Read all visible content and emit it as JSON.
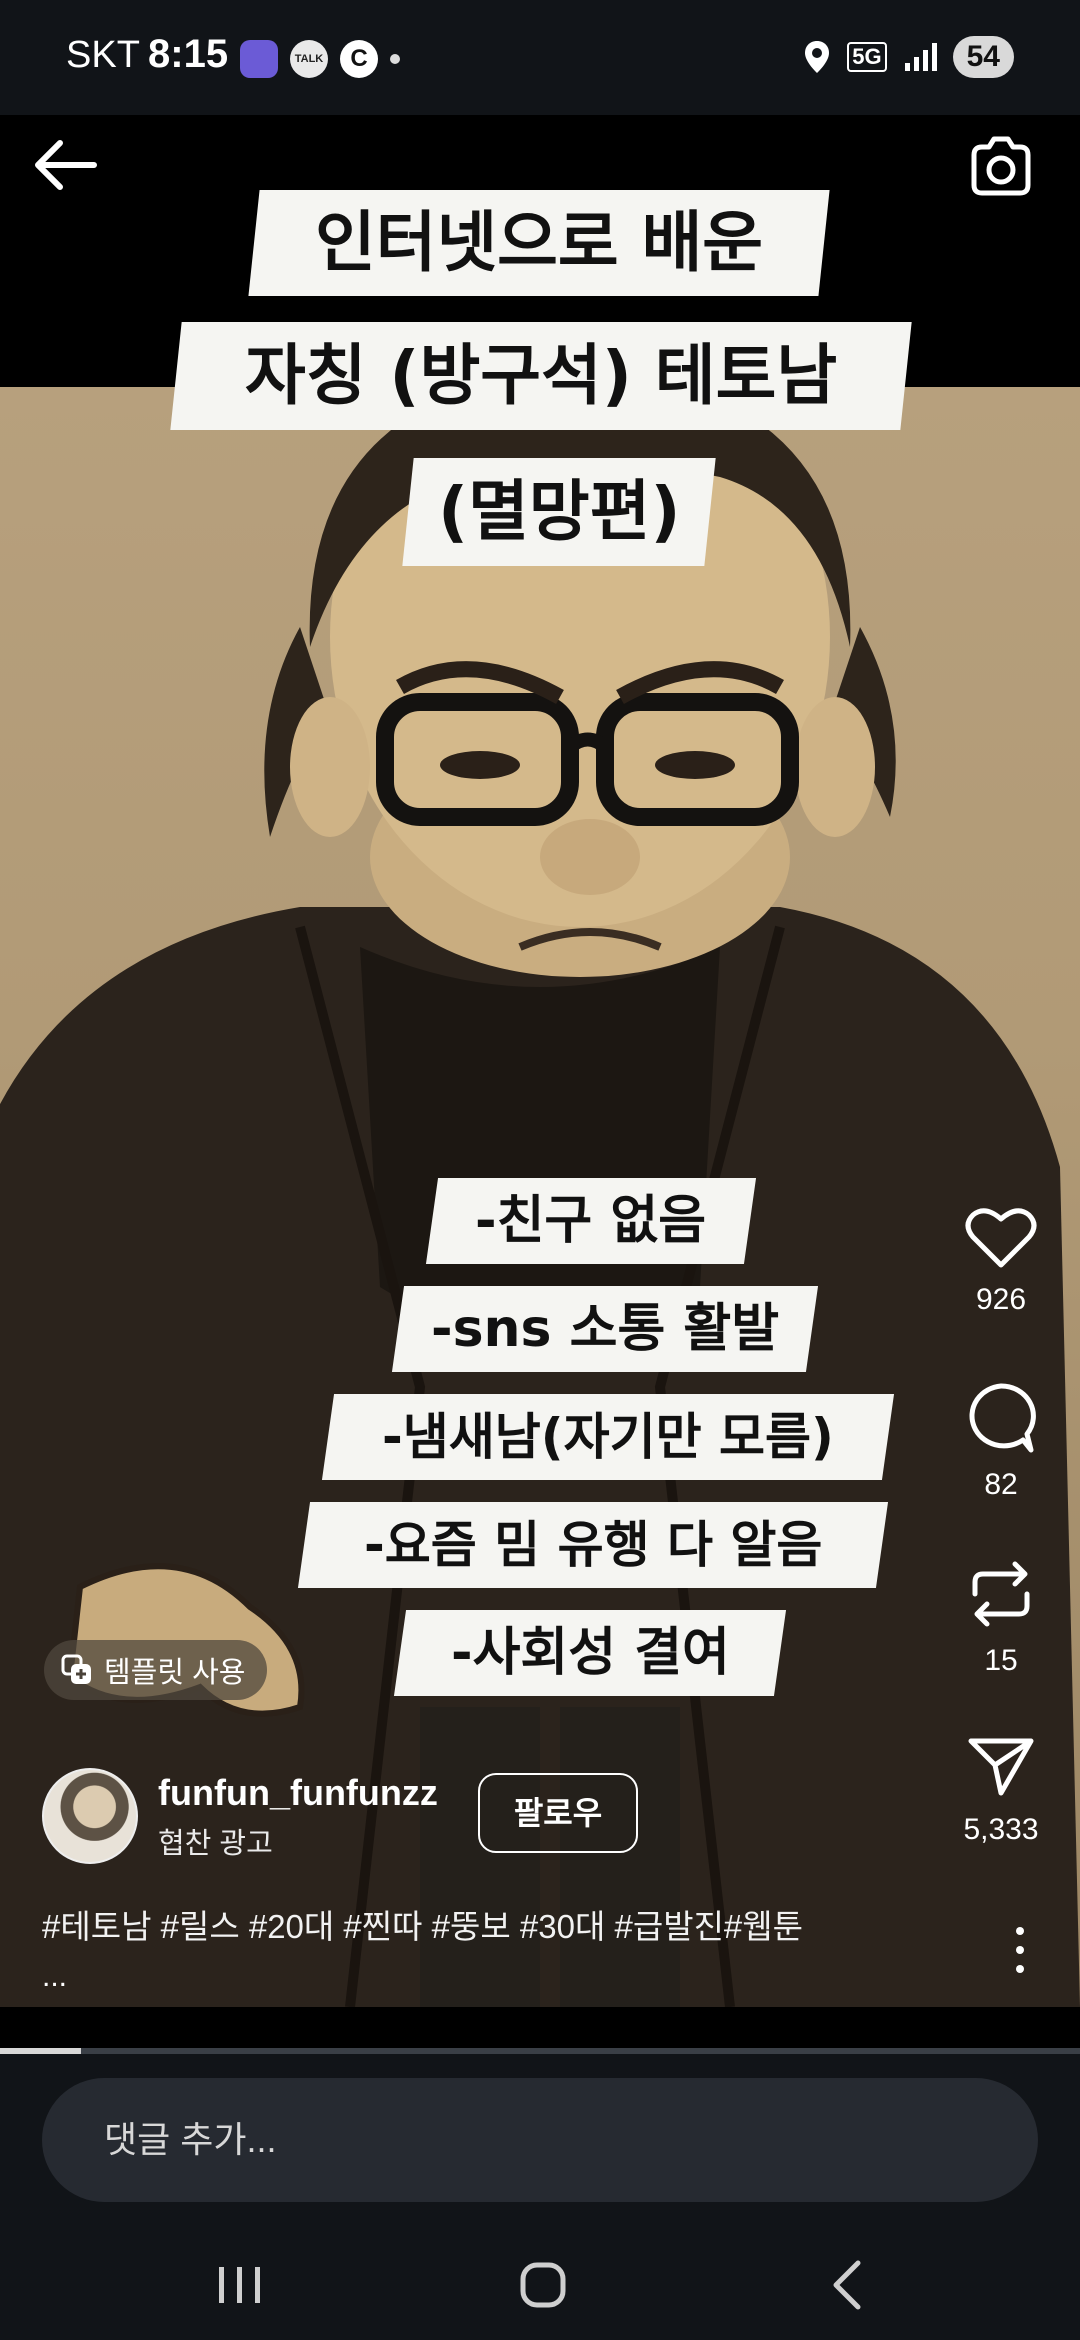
{
  "status_bar": {
    "carrier": "SKT",
    "time": "8:15",
    "talk_icon_label": "TALK",
    "c_icon_label": "C",
    "network": "5G",
    "battery": "54"
  },
  "post": {
    "title_lines": [
      "인터넷으로 배운",
      "자칭 (방구석) 테토남",
      "(멸망편)"
    ],
    "list_lines": [
      "-친구 없음",
      "-sns 소통 활발",
      "-냄새남(자기만  모름)",
      "-요즘 밈 유행 다 알음",
      "-사회성 결여"
    ],
    "template_label": "템플릿 사용",
    "username": "funfun_funfunzz",
    "sponsor_label": "협찬 광고",
    "follow_label": "팔로우",
    "hashtags": "#테토남 #릴스 #20대 #찐따 #뚱보 #30대 #급발진#웹툰",
    "more_caption": "...",
    "progress": 0.075
  },
  "actions": {
    "likes": "926",
    "comments": "82",
    "reposts": "15",
    "shares": "5,333"
  },
  "comment_input": {
    "placeholder": "댓글 추가..."
  },
  "icons": [
    "back-arrow-icon",
    "camera-icon",
    "heart-icon",
    "comment-icon",
    "repost-icon",
    "send-icon",
    "more-vertical-icon",
    "template-icon",
    "location-icon",
    "signal-icon"
  ]
}
